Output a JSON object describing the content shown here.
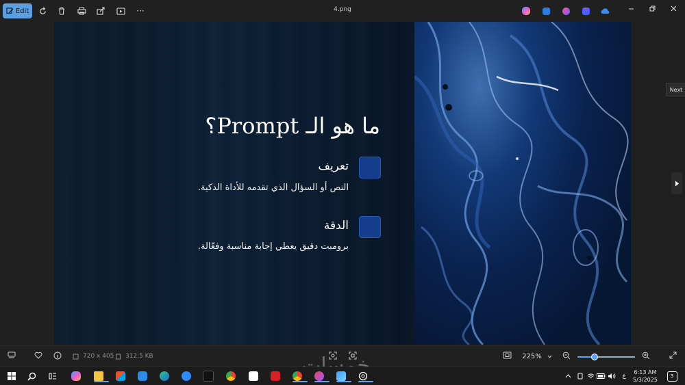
{
  "window": {
    "title": "4.png"
  },
  "toolbar": {
    "edit_label": "Edit",
    "more_label": "···"
  },
  "slide": {
    "title": "ما هو الـ Prompt؟",
    "items": [
      {
        "heading": "تعريف",
        "text": "النص أو السؤال الذي تقدمه للأداة الذكية."
      },
      {
        "heading": "الدقة",
        "text": "برومبت دقيق يعطي إجابة مناسبة وفعّالة."
      }
    ]
  },
  "nav": {
    "next_tooltip": "Next"
  },
  "statusbar": {
    "dimensions": "720 x 405",
    "file_size": "312.5 KB",
    "zoom": "225%",
    "zoom_level_fraction": 0.3
  },
  "taskbar": {
    "time": "6:13 AM",
    "date": "5/3/2025",
    "lang": "ع",
    "notifications": "3"
  },
  "watermark": "خمسات",
  "colors": {
    "accent": "#5ea1ff",
    "edit_button": "#5b9fe0",
    "square": "#143d8c"
  }
}
